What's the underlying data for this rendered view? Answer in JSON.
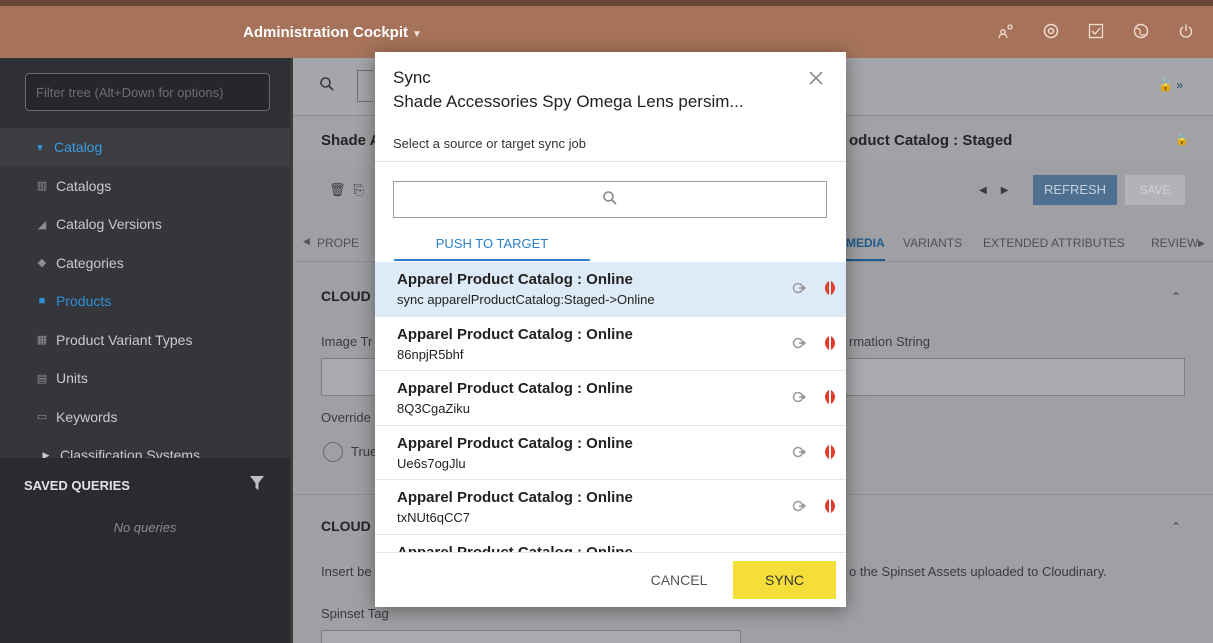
{
  "topbar": {
    "title": "Administration Cockpit",
    "icons": [
      "user-switch-icon",
      "help-icon",
      "checklist-icon",
      "globe-icon",
      "power-icon"
    ]
  },
  "sidebar": {
    "filter_placeholder": "Filter tree (Alt+Down for options)",
    "items": [
      {
        "label": "Catalog",
        "icon": "caret-down-icon"
      },
      {
        "label": "Catalogs",
        "icon": "catalogs-icon"
      },
      {
        "label": "Catalog Versions",
        "icon": "catalog-versions-icon"
      },
      {
        "label": "Categories",
        "icon": "tag-icon"
      },
      {
        "label": "Products",
        "icon": "product-icon"
      },
      {
        "label": "Product Variant Types",
        "icon": "variant-types-icon"
      },
      {
        "label": "Units",
        "icon": "units-icon"
      },
      {
        "label": "Keywords",
        "icon": "keyword-icon"
      },
      {
        "label": "Classification Systems",
        "icon": "caret-right-icon"
      }
    ],
    "saved_queries": {
      "header": "SAVED QUERIES",
      "empty": "No queries"
    }
  },
  "main": {
    "title_left": "Shade A",
    "title_right": "oduct Catalog : Staged",
    "refresh": "REFRESH",
    "save": "SAVE",
    "tabs": [
      "PROPE",
      "MEDIA",
      "VARIANTS",
      "EXTENDED ATTRIBUTES",
      "REVIEW"
    ],
    "section1": "CLOUD",
    "image_label": "Image Tr",
    "image_label_right": "rmation String",
    "override": "Override",
    "true_label": "True",
    "section2": "CLOUD",
    "insert_label": "Insert be",
    "insert_right": "o the Spinset Assets uploaded to Cloudinary.",
    "spinset": "Spinset Tag"
  },
  "modal": {
    "title_line1": "Sync",
    "title_line2": "Shade Accessories Spy Omega Lens persim...",
    "description": "Select a source or target sync job",
    "search_placeholder": "",
    "tab": "PUSH TO TARGET",
    "rows": [
      {
        "name": "Apparel Product Catalog : Online",
        "code": "sync apparelProductCatalog:Staged->Online"
      },
      {
        "name": "Apparel Product Catalog : Online",
        "code": "86npjR5bhf"
      },
      {
        "name": "Apparel Product Catalog : Online",
        "code": "8Q3CgaZiku"
      },
      {
        "name": "Apparel Product Catalog : Online",
        "code": "Ue6s7ogJlu"
      },
      {
        "name": "Apparel Product Catalog : Online",
        "code": "txNUt6qCC7"
      },
      {
        "name": "Apparel Product Catalog : Online",
        "code": ""
      }
    ],
    "cancel": "CANCEL",
    "sync": "SYNC"
  },
  "colors": {
    "topbar": "#a6735a",
    "accent_blue": "#2a7fc8",
    "sync_yellow": "#f5dd3a",
    "selected_row": "#dcebf7"
  }
}
